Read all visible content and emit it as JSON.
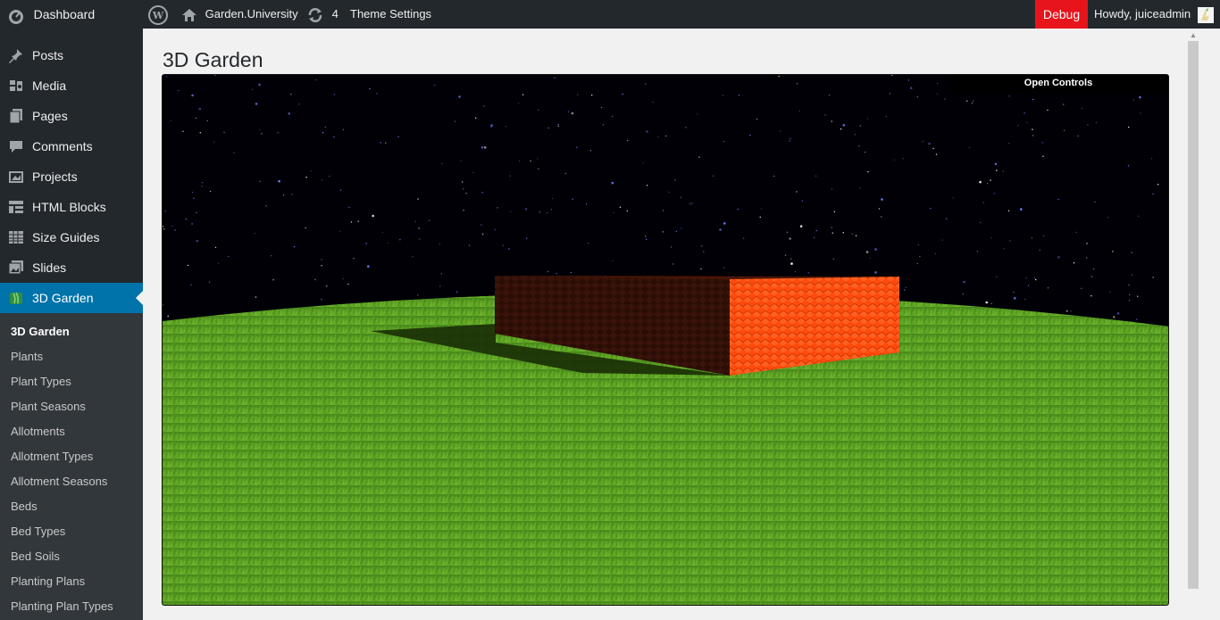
{
  "admin_bar": {
    "dashboard_label": "Dashboard",
    "site_name": "Garden.University",
    "updates_count": "4",
    "theme_settings_label": "Theme Settings",
    "debug_label": "Debug",
    "greeting": "Howdy, juiceadmin"
  },
  "sidebar": {
    "items": [
      {
        "label": "Posts",
        "icon": "pushpin-icon"
      },
      {
        "label": "Media",
        "icon": "media-icon"
      },
      {
        "label": "Pages",
        "icon": "pages-icon"
      },
      {
        "label": "Comments",
        "icon": "comments-icon"
      },
      {
        "label": "Projects",
        "icon": "portfolio-icon"
      },
      {
        "label": "HTML Blocks",
        "icon": "layout-icon"
      },
      {
        "label": "Size Guides",
        "icon": "table-icon"
      },
      {
        "label": "Slides",
        "icon": "images-icon"
      },
      {
        "label": "3D Garden",
        "icon": "plant-icon",
        "current": true
      }
    ],
    "submenu": [
      {
        "label": "3D Garden",
        "current": true
      },
      {
        "label": "Plants"
      },
      {
        "label": "Plant Types"
      },
      {
        "label": "Plant Seasons"
      },
      {
        "label": "Allotments"
      },
      {
        "label": "Allotment Types"
      },
      {
        "label": "Allotment Seasons"
      },
      {
        "label": "Beds"
      },
      {
        "label": "Bed Types"
      },
      {
        "label": "Bed Soils"
      },
      {
        "label": "Planting Plans"
      },
      {
        "label": "Planting Plan Types"
      }
    ]
  },
  "main": {
    "page_title": "3D Garden",
    "open_controls_label": "Open Controls"
  },
  "colors": {
    "admin_bg": "#23282d",
    "submenu_bg": "#32373c",
    "accent": "#0073aa",
    "debug": "#e8141b",
    "grass": "#5da32a",
    "sky": "#000008",
    "brick": "#ff4a0c"
  }
}
